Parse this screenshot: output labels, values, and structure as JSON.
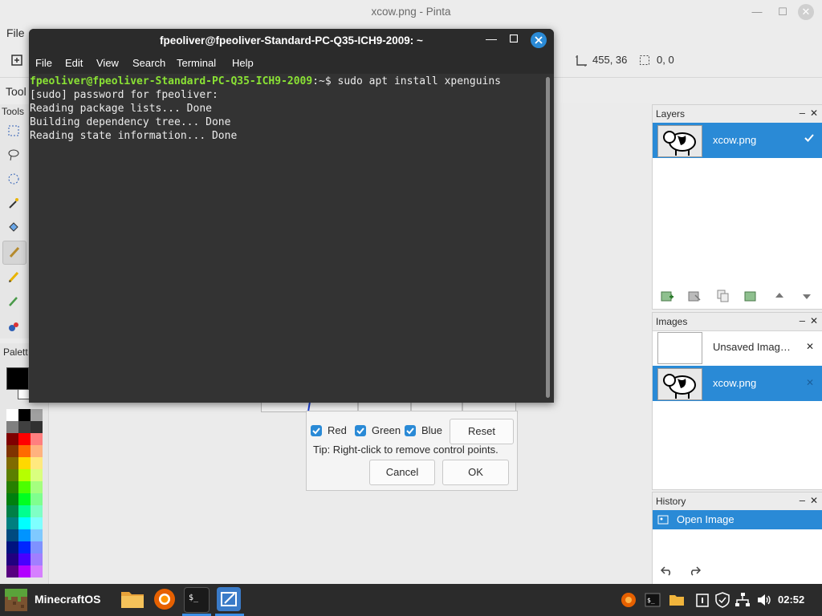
{
  "pinta": {
    "title": "xcow.png - Pinta",
    "menu_file": "File",
    "cursor_position": "455, 36",
    "selection_size": "0, 0",
    "tool_toggle_label": "Tool",
    "tools_header": "Tools",
    "palette_header": "Palett"
  },
  "terminal": {
    "title": "fpeoliver@fpeoliver-Standard-PC-Q35-ICH9-2009: ~",
    "menu": [
      "File",
      "Edit",
      "View",
      "Search",
      "Terminal",
      "Help"
    ],
    "prompt_user_host": "fpeoliver@fpeoliver-Standard-PC-Q35-ICH9-2009",
    "prompt_path": ":~",
    "prompt_command": "$ sudo apt install xpenguins",
    "output": [
      "[sudo] password for fpeoliver:",
      "Reading package lists... Done",
      "Building dependency tree... Done",
      "Reading state information... Done"
    ]
  },
  "curves_dialog": {
    "red_label": "Red",
    "green_label": "Green",
    "blue_label": "Blue",
    "reset_label": "Reset",
    "tip": "Tip: Right-click to remove control points.",
    "cancel_label": "Cancel",
    "ok_label": "OK"
  },
  "layers_panel": {
    "title": "Layers",
    "items": [
      {
        "name": "xcow.png",
        "visible": true
      }
    ]
  },
  "images_panel": {
    "title": "Images",
    "items": [
      {
        "name": "Unsaved Imag…"
      },
      {
        "name": "xcow.png"
      }
    ]
  },
  "history_panel": {
    "title": "History",
    "items": [
      {
        "label": "Open Image"
      }
    ]
  },
  "taskbar": {
    "start_label": "MinecraftOS",
    "clock": "02:52",
    "apps": [
      "file-manager-icon",
      "firefox-icon",
      "terminal-icon",
      "pinta-icon"
    ]
  },
  "colors": {
    "accent": "#2a8ad6",
    "terminal_bg": "#333333",
    "prompt_green": "#8ae234",
    "taskbar_bg": "#2b2b2b"
  }
}
